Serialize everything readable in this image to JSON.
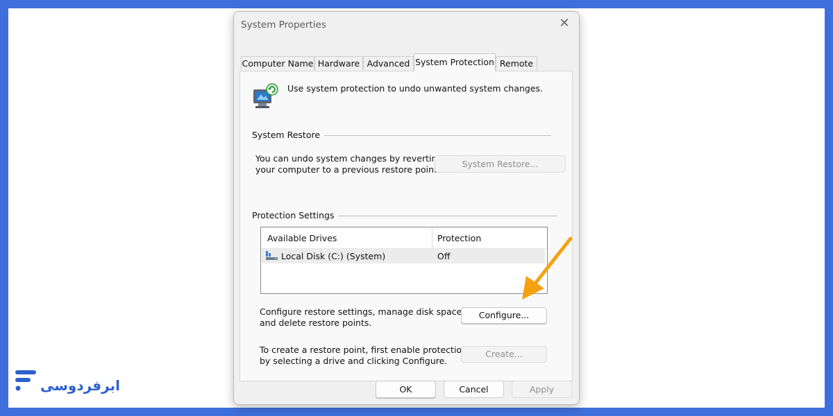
{
  "window": {
    "title": "System Properties",
    "close_glyph": "✕"
  },
  "tabs": [
    {
      "label": "Computer Name"
    },
    {
      "label": "Hardware"
    },
    {
      "label": "Advanced"
    },
    {
      "label": "System Protection",
      "active": true
    },
    {
      "label": "Remote"
    }
  ],
  "header": {
    "icon": "system-protection-icon",
    "text": "Use system protection to undo unwanted system changes."
  },
  "system_restore": {
    "group_label": "System Restore",
    "description_line1": "You can undo system changes by reverting",
    "description_line2": "your computer to a previous restore point.",
    "button_label": "System Restore..."
  },
  "protection_settings": {
    "group_label": "Protection Settings",
    "columns": [
      "Available Drives",
      "Protection"
    ],
    "drives": [
      {
        "icon": "drive-icon",
        "name": "Local Disk (C:) (System)",
        "protection": "Off"
      }
    ],
    "configure_text_line1": "Configure restore settings, manage disk space,",
    "configure_text_line2": "and delete restore points.",
    "configure_button": "Configure...",
    "create_text_line1": "To create a restore point, first enable protection",
    "create_text_line2": "by selecting a drive and clicking Configure.",
    "create_button": "Create..."
  },
  "footer": {
    "ok": "OK",
    "cancel": "Cancel",
    "apply": "Apply"
  },
  "brand": {
    "name": "ابرفردوسی",
    "color": "#2f5fcf"
  },
  "colors": {
    "frame": "#3f6fdc",
    "arrow": "#f5a10f"
  }
}
